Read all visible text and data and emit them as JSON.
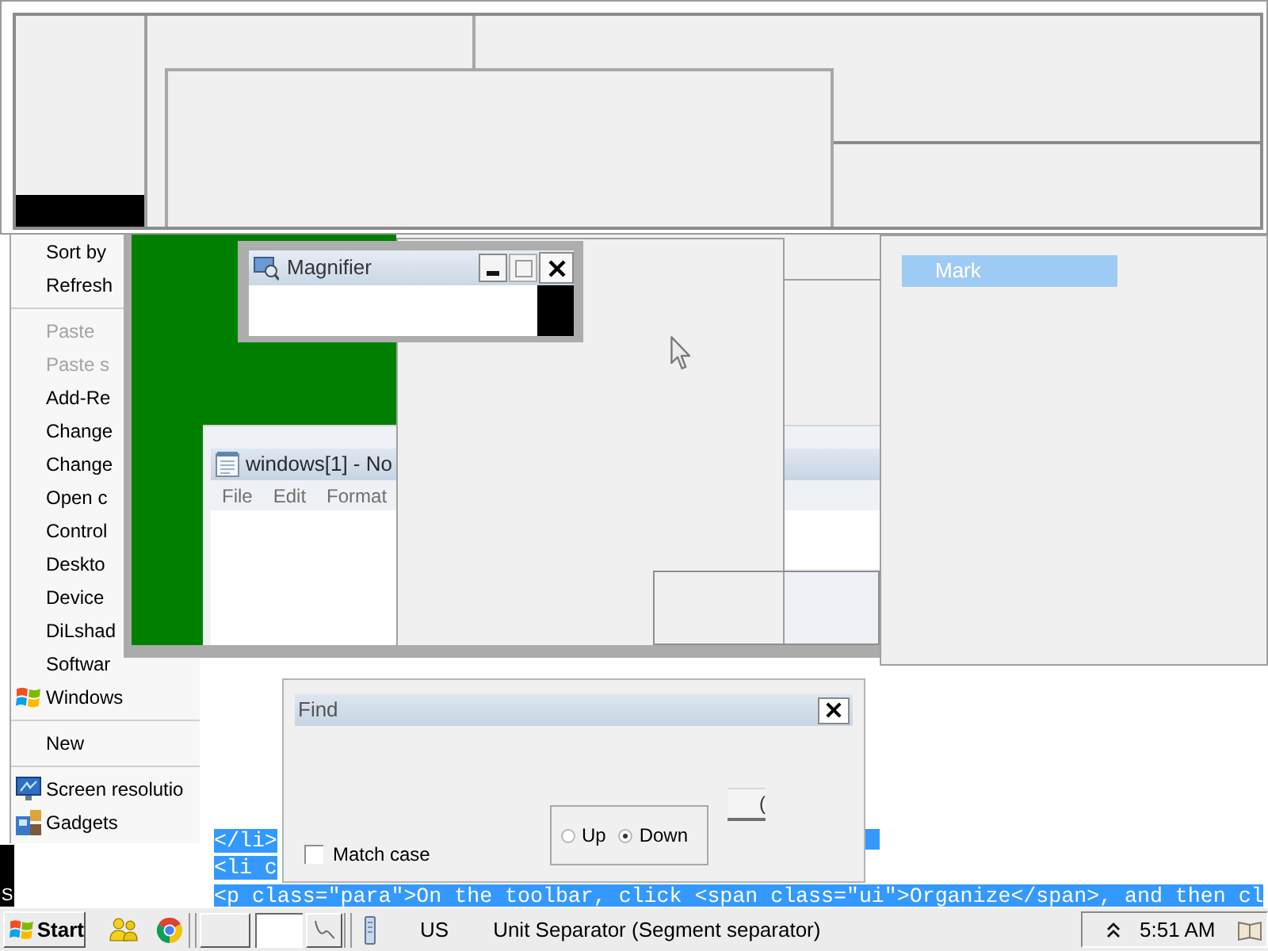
{
  "context_menu": {
    "items": [
      {
        "kind": "item",
        "label": "Sort by",
        "disabled": false
      },
      {
        "kind": "item",
        "label": "Refresh",
        "disabled": false
      },
      {
        "kind": "separator"
      },
      {
        "kind": "item",
        "label": "Paste",
        "disabled": true
      },
      {
        "kind": "item",
        "label": "Paste s",
        "disabled": true
      },
      {
        "kind": "item",
        "label": "Add-Re",
        "disabled": false
      },
      {
        "kind": "item",
        "label": "Change",
        "disabled": false
      },
      {
        "kind": "item",
        "label": "Change",
        "disabled": false
      },
      {
        "kind": "item",
        "label": "Open c",
        "disabled": false
      },
      {
        "kind": "item",
        "label": "Control",
        "disabled": false
      },
      {
        "kind": "item",
        "label": "Deskto",
        "disabled": false
      },
      {
        "kind": "item",
        "label": "Device",
        "disabled": false
      },
      {
        "kind": "item",
        "label": "DiLshad",
        "disabled": false
      },
      {
        "kind": "item",
        "label": "Softwar",
        "disabled": false
      },
      {
        "kind": "icon-item",
        "label": "Windows",
        "disabled": false
      },
      {
        "kind": "separator"
      },
      {
        "kind": "item",
        "label": "New",
        "disabled": false
      },
      {
        "kind": "separator"
      },
      {
        "kind": "icon-item",
        "label": "Screen resolutio",
        "disabled": false
      },
      {
        "kind": "icon-item",
        "label": "Gadgets",
        "disabled": false
      }
    ]
  },
  "magnifier": {
    "title": "Magnifier"
  },
  "notepad": {
    "title": "windows[1] - No",
    "menu": [
      "File",
      "Edit",
      "Format"
    ]
  },
  "side_panel": {
    "items": [
      {
        "label": "Mark",
        "selected": true
      }
    ]
  },
  "source_lines": [
    "</li>",
    "<li c",
    "<p class=\"para\">On the toolbar, click <span class=\"ui\">Organize</span>, and then cl"
  ],
  "find_dialog": {
    "title": "Find",
    "match_case": {
      "label": "Match case",
      "checked": false
    },
    "direction": [
      {
        "label": "Up",
        "selected": false
      },
      {
        "label": "Down",
        "selected": true
      }
    ],
    "partial_button": "("
  },
  "edge_text": "S",
  "taskbar": {
    "start": "Start",
    "language": "US",
    "character_name": "Unit Separator (Segment separator)",
    "clock": "5:51 AM"
  }
}
